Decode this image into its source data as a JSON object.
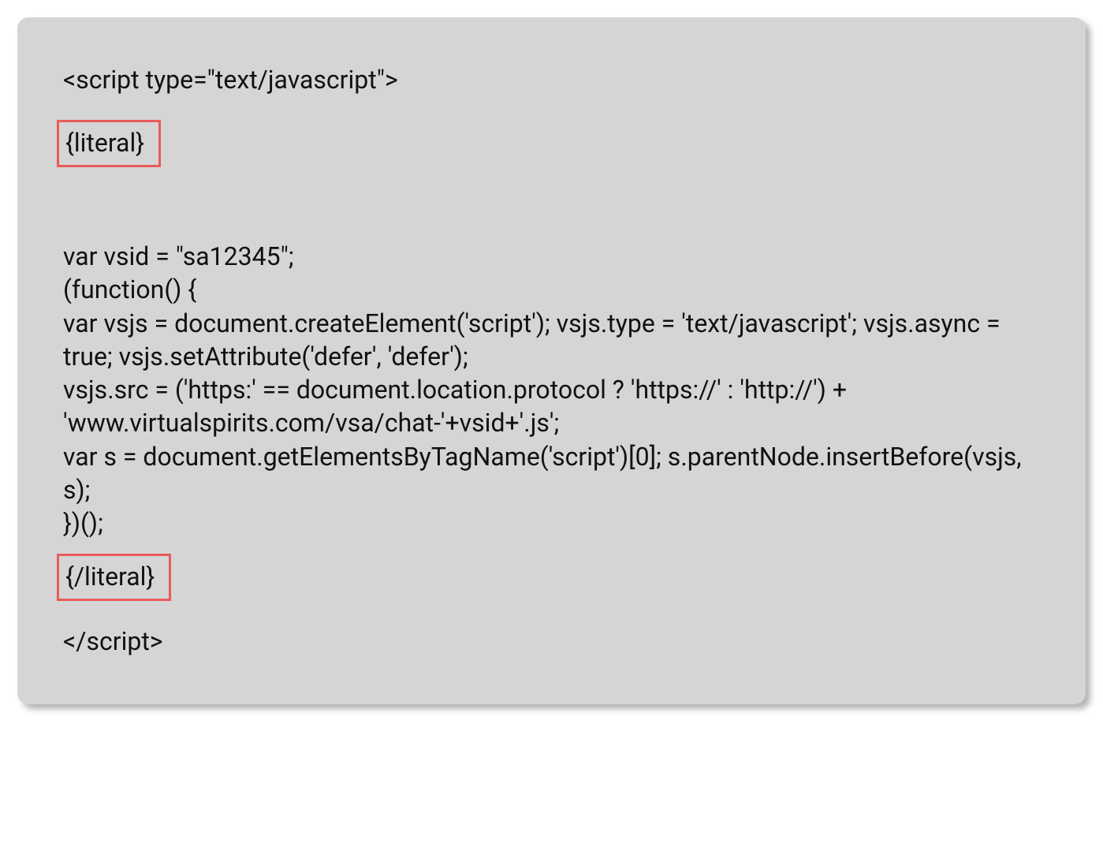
{
  "code": {
    "open_tag": "<script type=\"text/javascript\">",
    "literal_open": "{literal}",
    "body_line1": " var vsid = \"sa12345\";",
    "body_line2": " (function() {",
    "body_line3": " var vsjs = document.createElement('script'); vsjs.type = 'text/javascript'; vsjs.async = true; vsjs.setAttribute('defer', 'defer');",
    "body_line4": "  vsjs.src = ('https:' == document.location.protocol ? 'https://' : 'http://') + 'www.virtualspirits.com/vsa/chat-'+vsid+'.js';",
    "body_line5": "   var s = document.getElementsByTagName('script')[0]; s.parentNode.insertBefore(vsjs, s);",
    "body_line6": " })();",
    "literal_close": "{/literal}",
    "close_tag": "</script>"
  },
  "colors": {
    "panel_bg": "#d5d5d5",
    "highlight_border": "#e95a5a"
  }
}
